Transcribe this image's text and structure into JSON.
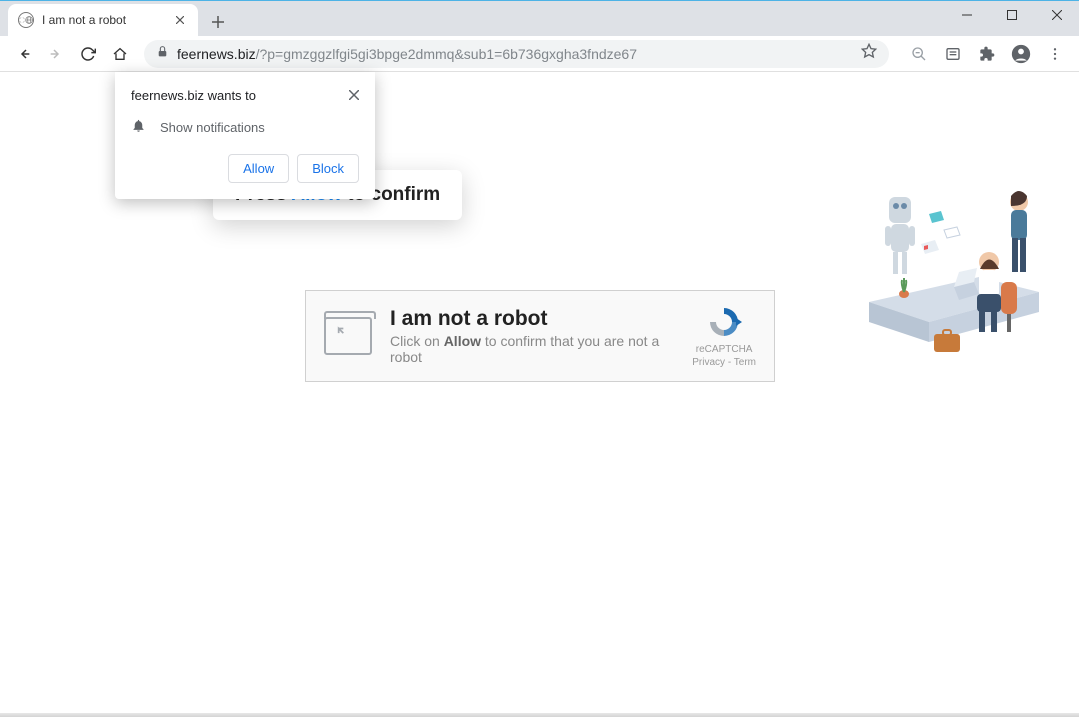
{
  "window": {
    "minimize": "—",
    "maximize": "☐",
    "close": "✕"
  },
  "tab": {
    "title": "I am not a robot"
  },
  "toolbar": {
    "url_domain": "feernews.biz",
    "url_path": "/?p=gmzggzlfgi5gi3bpge2dmmq&sub1=6b736gxgha3fndze67"
  },
  "perm": {
    "site_wants_to": "feernews.biz wants to",
    "show_notifications": "Show notifications",
    "allow": "Allow",
    "block": "Block"
  },
  "tooltip": {
    "press_prefix": "Press ",
    "press_highlight": "Allow",
    "press_suffix": " to confirm"
  },
  "captcha": {
    "title": "I am not a robot",
    "sub_prefix": "Click on ",
    "sub_bold": "Allow",
    "sub_suffix": " to confirm that you are not a robot",
    "badge_label": "reCAPTCHA",
    "privacy": "Privacy",
    "terms": "Term"
  }
}
